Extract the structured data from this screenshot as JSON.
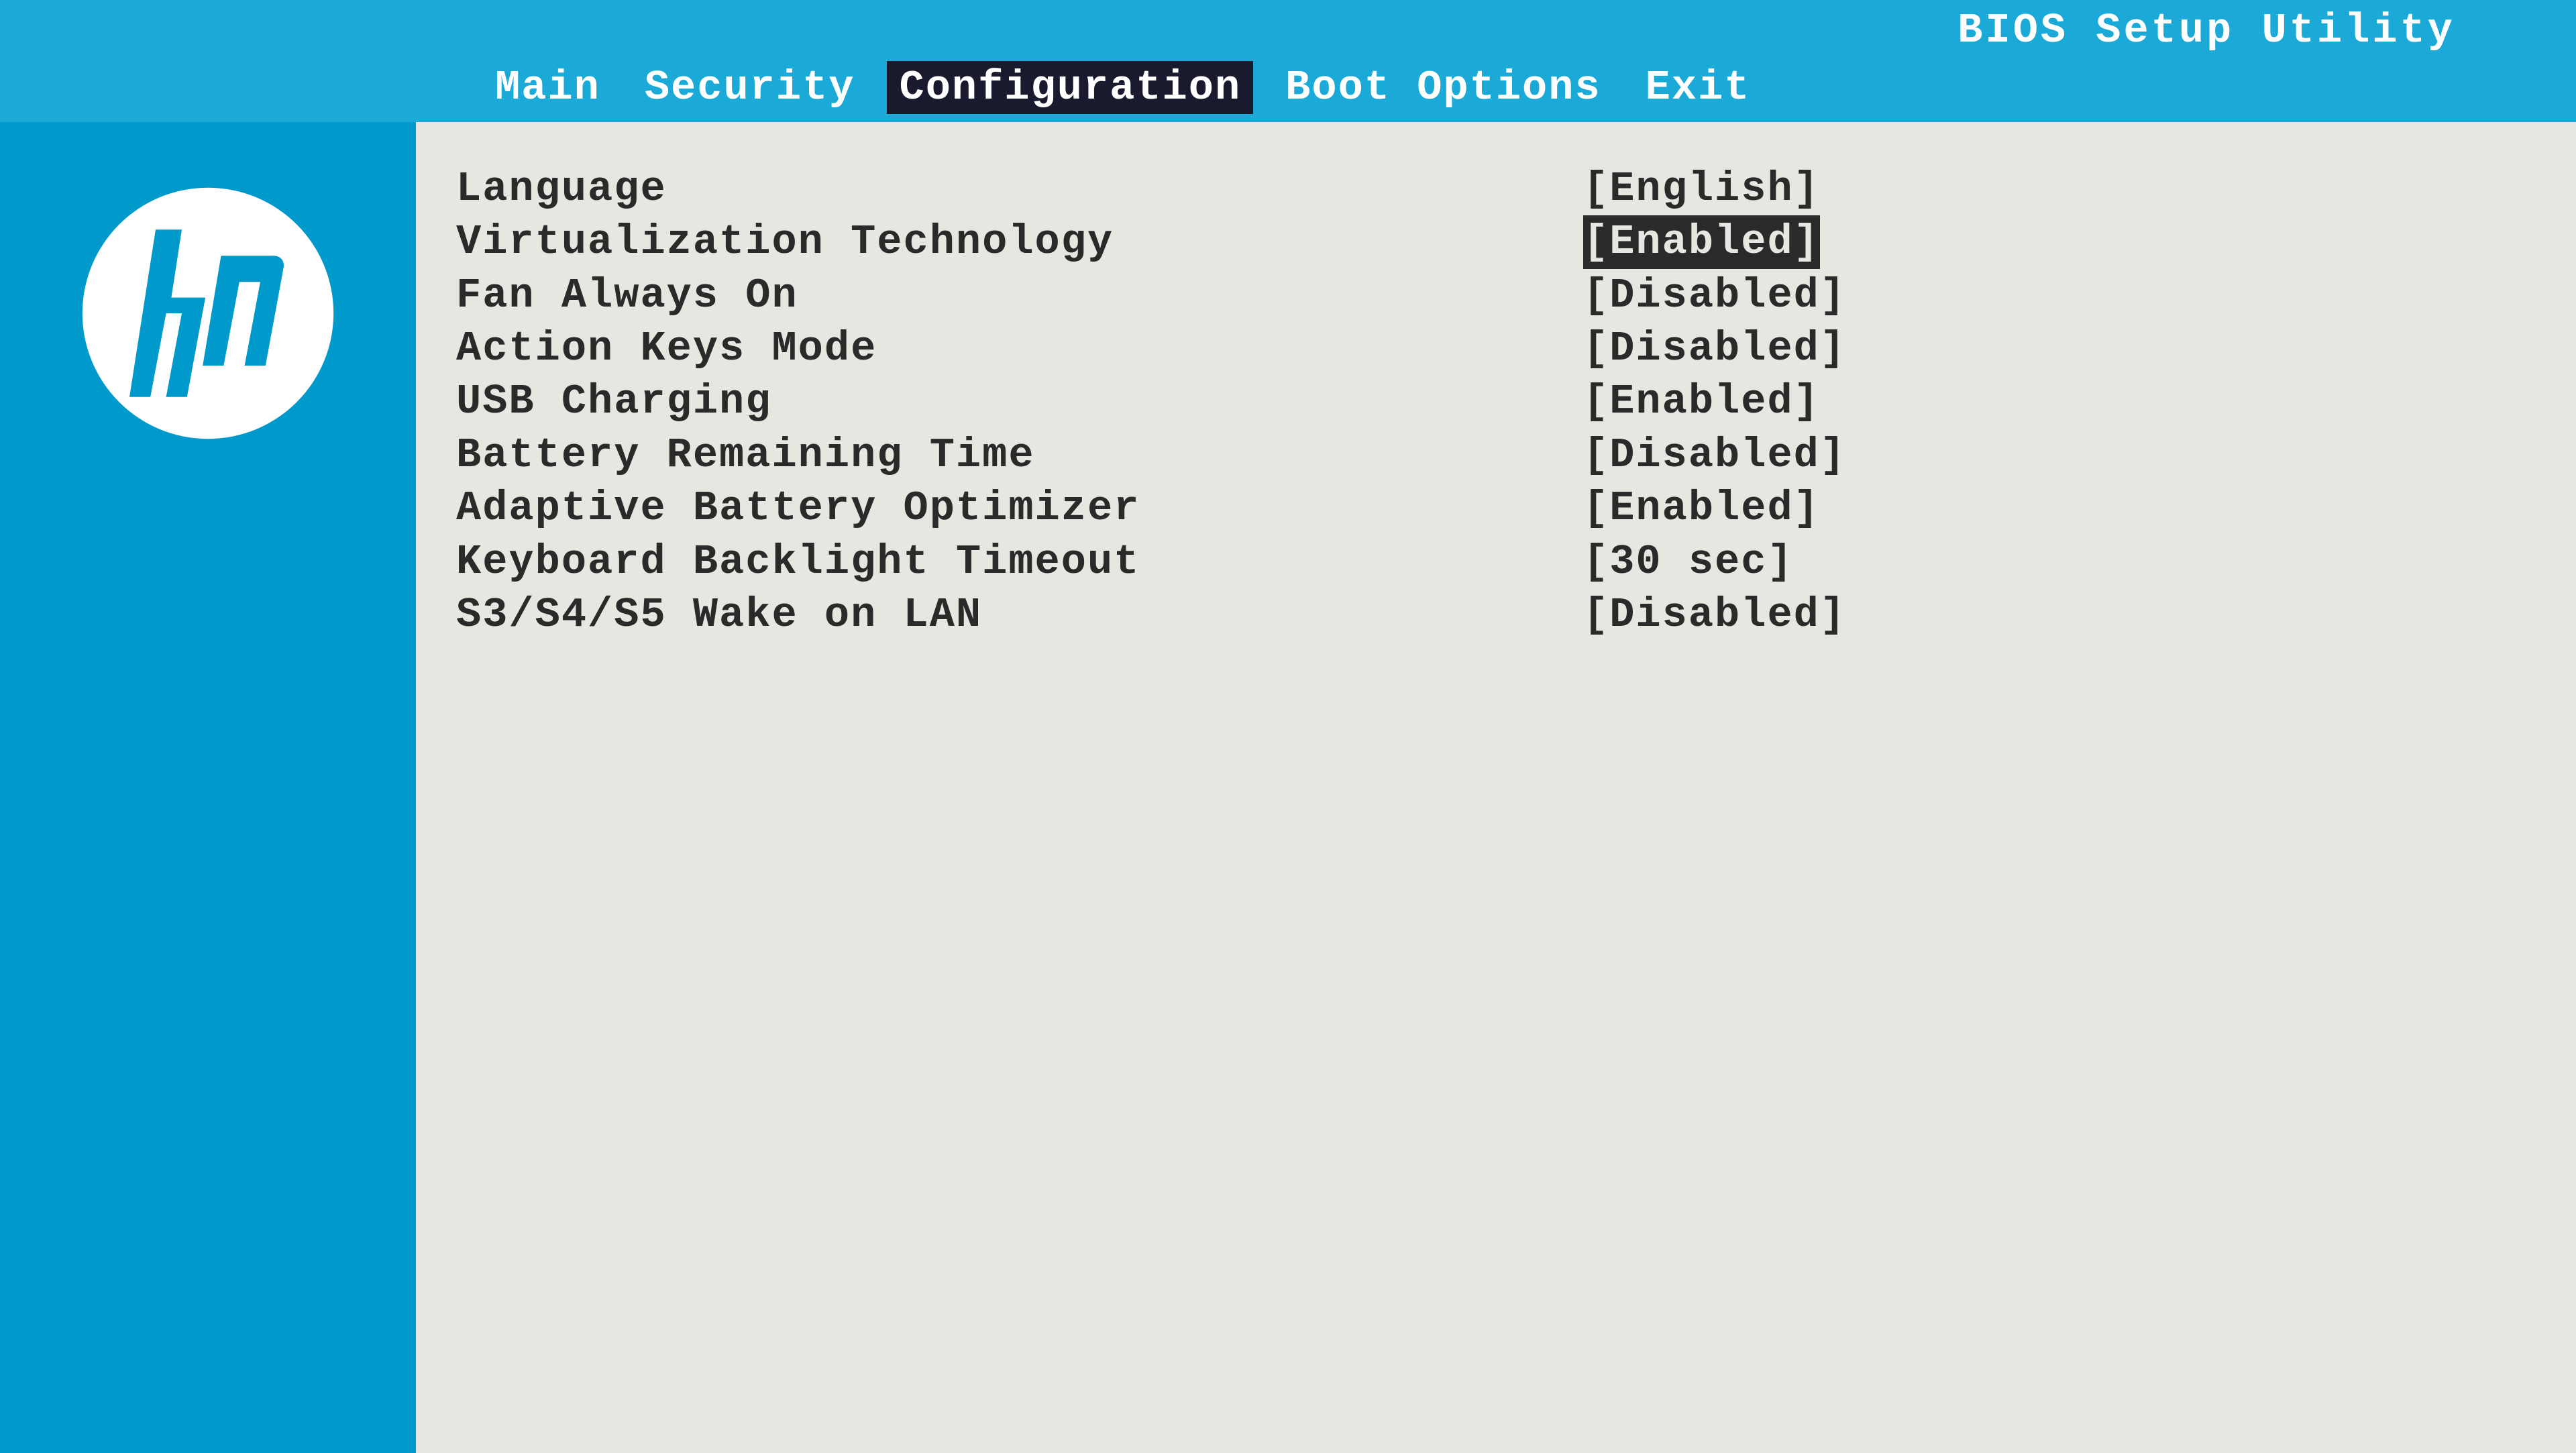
{
  "header": {
    "title": "BIOS Setup Utility",
    "menu": [
      {
        "label": "Main",
        "selected": false
      },
      {
        "label": "Security",
        "selected": false
      },
      {
        "label": "Configuration",
        "selected": true
      },
      {
        "label": "Boot Options",
        "selected": false
      },
      {
        "label": "Exit",
        "selected": false
      }
    ]
  },
  "brand": "hp",
  "settings": [
    {
      "label": "Language",
      "value": "[English]",
      "highlighted": false
    },
    {
      "label": "Virtualization Technology",
      "value": "[Enabled]",
      "highlighted": true
    },
    {
      "label": "Fan Always On",
      "value": "[Disabled]",
      "highlighted": false
    },
    {
      "label": "Action Keys Mode",
      "value": "[Disabled]",
      "highlighted": false
    },
    {
      "label": "USB Charging",
      "value": "[Enabled]",
      "highlighted": false
    },
    {
      "label": "Battery Remaining Time",
      "value": "[Disabled]",
      "highlighted": false
    },
    {
      "label": "Adaptive Battery Optimizer",
      "value": "[Enabled]",
      "highlighted": false
    },
    {
      "label": "Keyboard Backlight Timeout",
      "value": "[30 sec]",
      "highlighted": false
    },
    {
      "label": "S3/S4/S5 Wake on LAN",
      "value": "[Disabled]",
      "highlighted": false
    }
  ]
}
